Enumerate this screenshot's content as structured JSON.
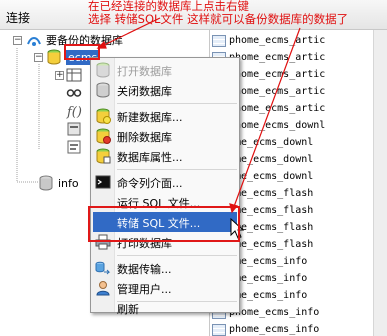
{
  "left_panel": {
    "header_label": "连接",
    "tree": {
      "root_label": "要备份的数据库",
      "selected_db_label": "ecms",
      "bottom_node_label": "info"
    }
  },
  "annotation": {
    "line1": "在已经连接的数据库上点击右键",
    "line2": "选择 转储SQL文件 这样就可以备份数据库的数据了"
  },
  "context_menu": {
    "items": [
      {
        "label": "打开数据库",
        "icon": "database-open-icon",
        "disabled": true
      },
      {
        "label": "关闭数据库",
        "icon": "database-close-icon",
        "disabled": false
      },
      {
        "label": "新建数据库...",
        "icon": "database-new-icon",
        "disabled": false
      },
      {
        "label": "删除数据库",
        "icon": "database-delete-icon",
        "disabled": false
      },
      {
        "label": "数据库属性...",
        "icon": "database-properties-icon",
        "disabled": false
      },
      {
        "label": "命令列介面...",
        "icon": "console-icon",
        "disabled": false
      },
      {
        "label": "运行 SQL 文件...",
        "icon": "blank",
        "disabled": false
      },
      {
        "label": "转储 SQL 文件...",
        "icon": "blank",
        "disabled": false,
        "highlighted": true
      },
      {
        "label": "打印数据库",
        "icon": "printer-icon",
        "disabled": false
      },
      {
        "label": "数据传输...",
        "icon": "data-transfer-icon",
        "disabled": false
      },
      {
        "label": "管理用户...",
        "icon": "user-icon",
        "disabled": false
      },
      {
        "label": "刷新",
        "icon": "blank",
        "disabled": false
      }
    ]
  },
  "right_panel": {
    "header_label": "",
    "tables": [
      "phome_ecms_artic",
      "phome_ecms_artic",
      "phome_ecms_artic",
      "phome_ecms_artic",
      "phome_ecms_artic",
      "phome_ecms_downl",
      "ome_ecms_downl",
      "ome_ecms_downl",
      "ome_ecms_downl",
      "ome_ecms_flash",
      "ome_ecms_flash",
      "ome_ecms_flash",
      "ome_ecms_flash",
      "ome_ecms_info",
      "ome_ecms_info",
      "ome_ecms_info",
      "phome_ecms_info",
      "phome_ecms_info"
    ]
  },
  "colors": {
    "annotation_red": "#e01010",
    "selection_blue": "#316ac5"
  }
}
